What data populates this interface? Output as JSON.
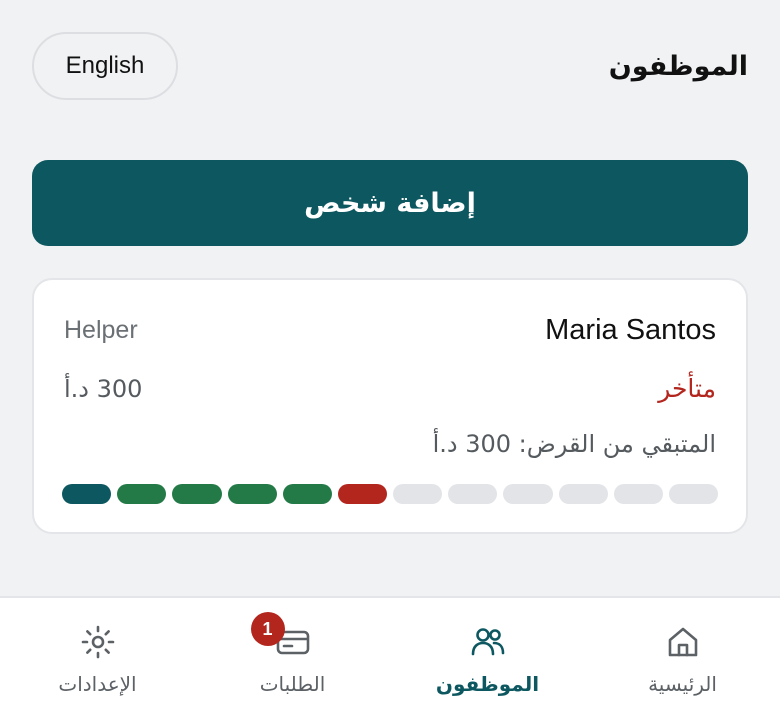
{
  "header": {
    "title": "الموظفون",
    "language_button": "English"
  },
  "add_person_button": "إضافة شخص",
  "employee_card": {
    "name": "Maria Santos",
    "role": "Helper",
    "status": "متأخر",
    "amount": "300 د.أ",
    "remaining_loan": "المتبقي من القرض: 300 د.أ",
    "installments": [
      "current",
      "paid",
      "paid",
      "paid",
      "paid",
      "late",
      "pending",
      "pending",
      "pending",
      "pending",
      "pending",
      "pending"
    ]
  },
  "bottom_nav": {
    "items": [
      {
        "label": "الرئيسية",
        "icon": "home-icon"
      },
      {
        "label": "الموظفون",
        "icon": "people-icon",
        "active": true
      },
      {
        "label": "الطلبات",
        "icon": "card-icon",
        "badge": "1"
      },
      {
        "label": "الإعدادات",
        "icon": "sun-settings-icon"
      }
    ]
  },
  "colors": {
    "primary": "#0d5860",
    "paid": "#237a47",
    "late": "#b3261e",
    "pending": "#e2e4e7"
  }
}
